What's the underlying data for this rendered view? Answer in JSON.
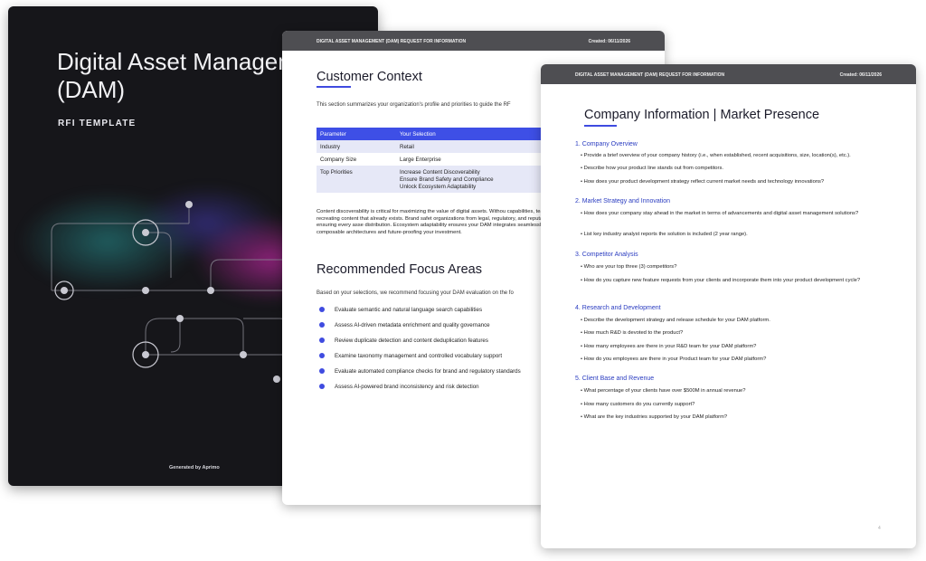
{
  "cover": {
    "title": "Digital Asset Management (DAM)",
    "subtitle": "RFI TEMPLATE",
    "footer": "Generated by Aprimo",
    "colors": {
      "background": "#16161a",
      "glow_magenta": "#c828aa",
      "glow_teal": "#289696"
    }
  },
  "header": {
    "left": "DIGITAL ASSET MANAGEMENT (DAM) REQUEST FOR INFORMATION",
    "right": "Created: 06/11/2026"
  },
  "page2": {
    "heading": "Customer Context",
    "intro": "This section summarizes your organization's profile and priorities to guide the RF",
    "table": {
      "headers": [
        "Parameter",
        "Your Selection"
      ],
      "rows": [
        {
          "param": "Industry",
          "value": "Retail"
        },
        {
          "param": "Company Size",
          "value": "Large Enterprise"
        },
        {
          "param": "Top Priorities",
          "value": "Increase Content Discoverability\nEnsure Brand Safety and Compliance\nUnlock Ecosystem Adaptability"
        }
      ]
    },
    "paragraph": "Content discoverability is critical for maximizing the value of digital assets. Withou capabilities, teams waste time recreating content that already exists. Brand safet organizations from legal, regulatory, and reputational risk by ensuring every asse distribution. Ecosystem adaptability ensures your DAM integrates seamlessly wit enabling composable architectures and future-proofing your investment.",
    "focus_heading": "Recommended Focus Areas",
    "focus_intro": "Based on your selections, we recommend focusing your DAM evaluation on the fo",
    "focus_items": [
      "Evaluate semantic and natural language search capabilities",
      "Assess AI-driven metadata enrichment and quality governance",
      "Review duplicate detection and content deduplication features",
      "Examine taxonomy management and controlled vocabulary support",
      "Evaluate automated compliance checks for brand and regulatory standards",
      "Assess AI-powered brand inconsistency and risk detection"
    ],
    "accent_color": "#3f4be0"
  },
  "page3": {
    "heading": "Company Information | Market Presence",
    "sections": [
      {
        "title": "1. Company Overview",
        "questions": [
          "• Provide a brief overview of your company history (i.e., when established, recent acquisitions, size, location(s), etc.).",
          "• Describe how your product line stands out from competitors.",
          "• How does your product development strategy reflect current market needs and technology innovations?"
        ]
      },
      {
        "title": "2. Market Strategy and Innovation",
        "questions": [
          "• How does your company stay ahead in the market in terms of advancements and digital asset management solutions?",
          "• List key industry analyst reports the solution is included (2 year range)."
        ]
      },
      {
        "title": "3. Competitor Analysis",
        "questions": [
          "• Who are your top three (3) competitors?",
          "• How do you capture new feature requests from your clients and incorporate them into your product development cycle?"
        ]
      },
      {
        "title": "4. Research and Development",
        "questions": [
          "• Describe the development strategy and release schedule for your DAM platform.",
          "• How much R&D is devoted to the product?",
          "• How many employees are there in your R&D team for your DAM platform?",
          "• How do you employees are there in your Product team for your DAM platform?"
        ]
      },
      {
        "title": "5. Client Base and Revenue",
        "questions": [
          "• What percentage of your clients have over $500M in annual revenue?",
          "• How many customers do you currently support?",
          "• What are the key industries supported by your DAM platform?"
        ]
      }
    ],
    "page_number": "4"
  }
}
